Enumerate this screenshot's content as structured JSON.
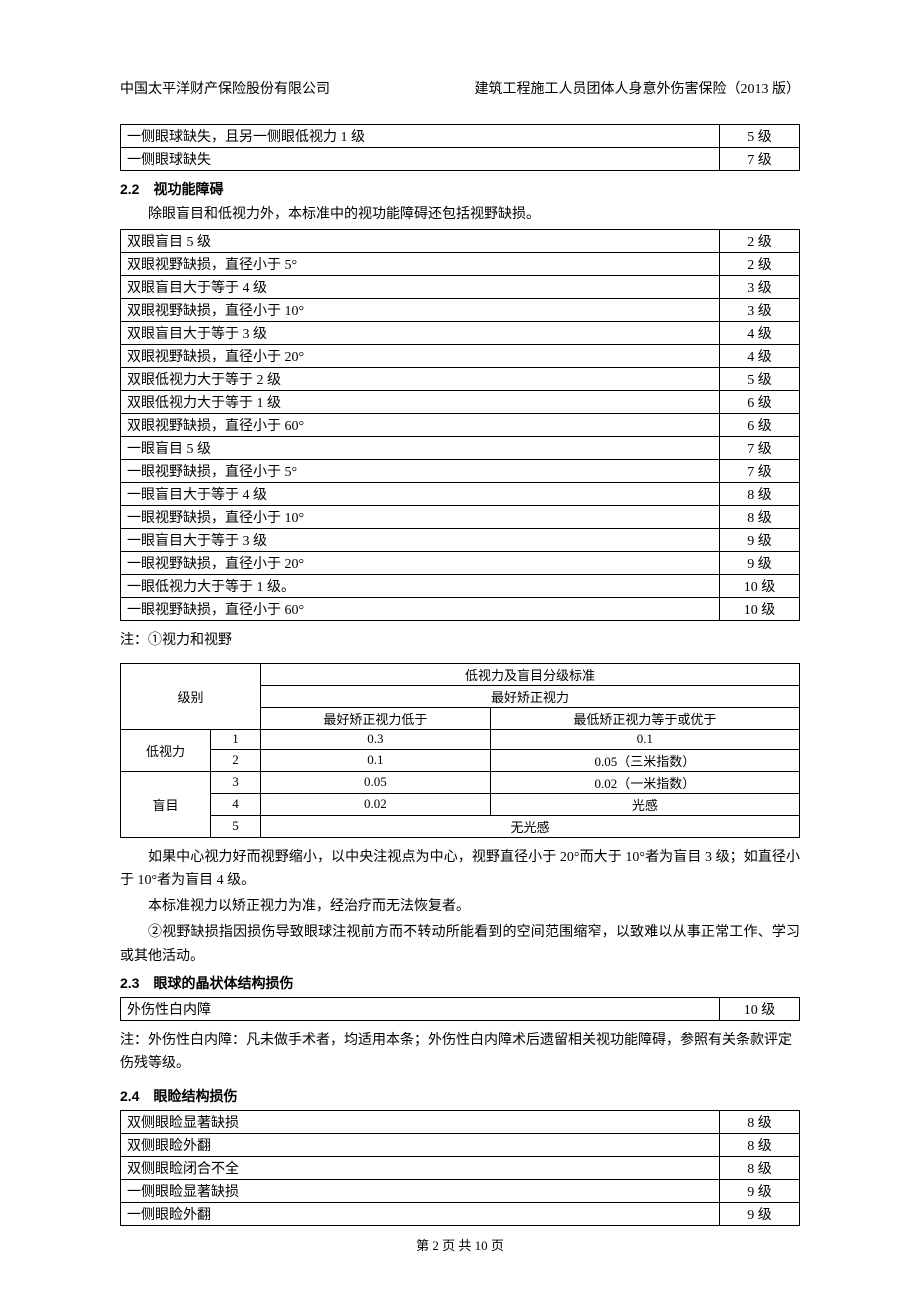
{
  "header": {
    "left": "中国太平洋财产保险股份有限公司",
    "right": "建筑工程施工人员团体人身意外伤害保险（2013 版）"
  },
  "table_top": {
    "rows": [
      {
        "desc": "一侧眼球缺失，且另一侧眼低视力 1 级",
        "level": "5 级"
      },
      {
        "desc": "一侧眼球缺失",
        "level": "7 级"
      }
    ]
  },
  "section22": {
    "title": "2.2　视功能障碍",
    "intro": "除眼盲目和低视力外，本标准中的视功能障碍还包括视野缺损。",
    "rows": [
      {
        "desc": "双眼盲目 5 级",
        "level": "2 级"
      },
      {
        "desc": "双眼视野缺损，直径小于 5°",
        "level": "2 级"
      },
      {
        "desc": "双眼盲目大于等于 4 级",
        "level": "3 级"
      },
      {
        "desc": "双眼视野缺损，直径小于 10°",
        "level": "3 级"
      },
      {
        "desc": "双眼盲目大于等于 3 级",
        "level": "4 级"
      },
      {
        "desc": "双眼视野缺损，直径小于 20°",
        "level": "4 级"
      },
      {
        "desc": "双眼低视力大于等于 2 级",
        "level": "5 级"
      },
      {
        "desc": "双眼低视力大于等于 1 级",
        "level": "6 级"
      },
      {
        "desc": "双眼视野缺损，直径小于 60°",
        "level": "6 级"
      },
      {
        "desc": "一眼盲目 5 级",
        "level": "7 级"
      },
      {
        "desc": "一眼视野缺损，直径小于 5°",
        "level": "7 级"
      },
      {
        "desc": "一眼盲目大于等于 4 级",
        "level": "8 级"
      },
      {
        "desc": "一眼视野缺损，直径小于 10°",
        "level": "8 级"
      },
      {
        "desc": "一眼盲目大于等于 3 级",
        "level": "9 级"
      },
      {
        "desc": "一眼视野缺损，直径小于 20°",
        "level": "9 级"
      },
      {
        "desc": "一眼低视力大于等于 1 级。",
        "level": "10 级"
      },
      {
        "desc": "一眼视野缺损，直径小于 60°",
        "level": "10 级"
      }
    ]
  },
  "note1_label": "注：①视力和视野",
  "sub_table": {
    "h_level": "级别",
    "h_standard": "低视力及盲目分级标准",
    "h_best": "最好矫正视力",
    "h_below": "最好矫正视力低于",
    "h_atleast": "最低矫正视力等于或优于",
    "cat_low": "低视力",
    "cat_blind": "盲目",
    "rows": [
      {
        "n": "1",
        "below": "0.3",
        "atleast": "0.1"
      },
      {
        "n": "2",
        "below": "0.1",
        "atleast": "0.05（三米指数）"
      },
      {
        "n": "3",
        "below": "0.05",
        "atleast": "0.02（一米指数）"
      },
      {
        "n": "4",
        "below": "0.02",
        "atleast": "光感"
      },
      {
        "n": "5",
        "below_span": "无光感"
      }
    ]
  },
  "paras": {
    "p1": "如果中心视力好而视野缩小，以中央注视点为中心，视野直径小于 20°而大于 10°者为盲目 3 级；如直径小于 10°者为盲目 4 级。",
    "p2": "本标准视力以矫正视力为准，经治疗而无法恢复者。",
    "p3": "②视野缺损指因损伤导致眼球注视前方而不转动所能看到的空间范围缩窄，以致难以从事正常工作、学习或其他活动。"
  },
  "section23": {
    "title": "2.3　眼球的晶状体结构损伤",
    "rows": [
      {
        "desc": "外伤性白内障",
        "level": "10 级"
      }
    ],
    "note": "注：外伤性白内障：凡未做手术者，均适用本条；外伤性白内障术后遗留相关视功能障碍，参照有关条款评定伤残等级。"
  },
  "section24": {
    "title": "2.4　眼睑结构损伤",
    "rows": [
      {
        "desc": "双侧眼睑显著缺损",
        "level": "8 级"
      },
      {
        "desc": "双侧眼睑外翻",
        "level": "8 级"
      },
      {
        "desc": "双侧眼睑闭合不全",
        "level": "8 级"
      },
      {
        "desc": "一侧眼睑显著缺损",
        "level": "9 级"
      },
      {
        "desc": "一侧眼睑外翻",
        "level": "9 级"
      }
    ]
  },
  "footer": "第 2 页 共 10 页"
}
